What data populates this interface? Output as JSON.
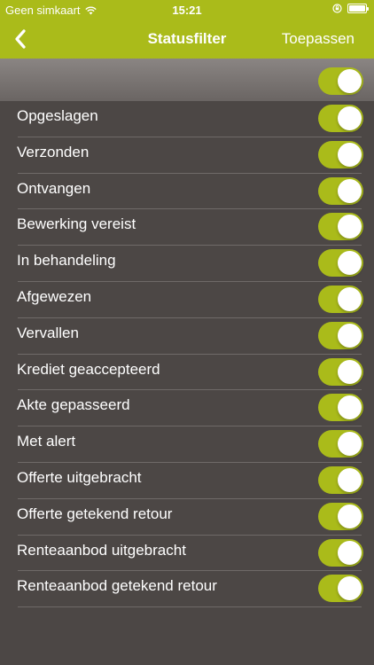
{
  "status_bar": {
    "carrier": "Geen simkaart",
    "time": "15:21"
  },
  "nav": {
    "title": "Statusfilter",
    "apply_label": "Toepassen"
  },
  "header_toggle": {
    "on": true
  },
  "filters": [
    {
      "label": "Opgeslagen",
      "on": true
    },
    {
      "label": "Verzonden",
      "on": true
    },
    {
      "label": "Ontvangen",
      "on": true
    },
    {
      "label": "Bewerking vereist",
      "on": true
    },
    {
      "label": "In behandeling",
      "on": true
    },
    {
      "label": "Afgewezen",
      "on": true
    },
    {
      "label": "Vervallen",
      "on": true
    },
    {
      "label": "Krediet geaccepteerd",
      "on": true
    },
    {
      "label": "Akte gepasseerd",
      "on": true
    },
    {
      "label": "Met alert",
      "on": true
    },
    {
      "label": "Offerte uitgebracht",
      "on": true
    },
    {
      "label": "Offerte getekend retour",
      "on": true
    },
    {
      "label": "Renteaanbod uitgebracht",
      "on": true
    },
    {
      "label": "Renteaanbod getekend retour",
      "on": true
    }
  ],
  "colors": {
    "accent": "#aabb1a",
    "background": "#4c4745"
  },
  "icons": {
    "back": "chevron-left-icon",
    "wifi": "wifi-icon",
    "lock": "rotation-lock-icon",
    "battery": "battery-icon"
  }
}
